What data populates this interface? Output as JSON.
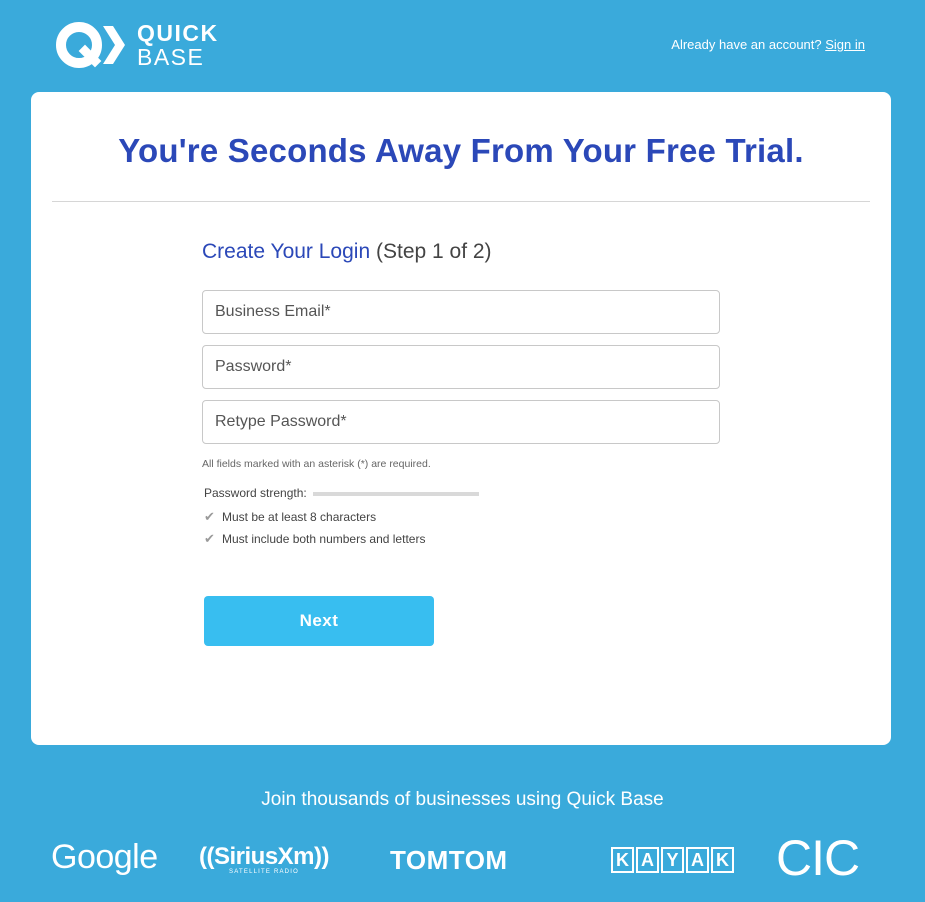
{
  "brand": {
    "logo_line1": "QUICK",
    "logo_line2": "BASE"
  },
  "header": {
    "account_prompt": "Already have an account?",
    "signin_label": "Sign in"
  },
  "card": {
    "headline": "You're Seconds Away From Your Free Trial.",
    "step_title": "Create Your Login",
    "step_counter": "(Step 1 of 2)",
    "fields": {
      "email_placeholder": "Business Email*",
      "password_placeholder": "Password*",
      "retype_placeholder": "Retype Password*"
    },
    "required_note": "All fields marked with an asterisk (*) are required.",
    "strength_label": "Password strength:",
    "strength_value": 0,
    "rules": [
      "Must be at least 8 characters",
      "Must include both numbers and letters"
    ],
    "next_label": "Next"
  },
  "footer": {
    "join_text": "Join thousands of businesses using Quick Base",
    "logos": {
      "google": "Google",
      "siriusxm": "((SiriusXm))",
      "siriusxm_sub": "SATELLITE RADIO",
      "tomtom": "TOMTOM",
      "kayak": [
        "K",
        "A",
        "Y",
        "A",
        "K"
      ],
      "cic": "CIC"
    }
  },
  "colors": {
    "background": "#3aaadb",
    "headline": "#2b48b8",
    "button": "#38bef0"
  }
}
